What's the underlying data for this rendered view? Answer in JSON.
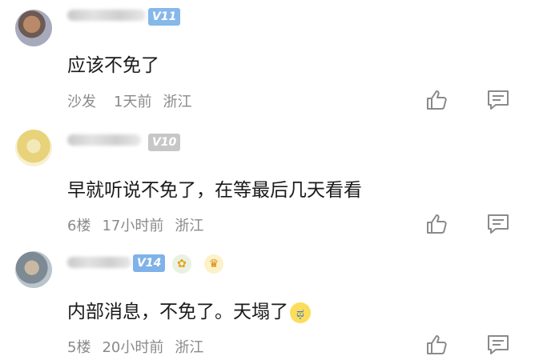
{
  "comments": [
    {
      "badge": "V11",
      "text": "应该不免了",
      "meta": {
        "floor": "沙发",
        "time": "1天前",
        "location": "浙江"
      }
    },
    {
      "badge": "V10",
      "text": "早就听说不免了，在等最后几天看看",
      "meta": {
        "floor": "6楼",
        "time": "17小时前",
        "location": "浙江"
      }
    },
    {
      "badge": "V14",
      "text": "内部消息，不免了。天塌了",
      "meta": {
        "floor": "5楼",
        "time": "20小时前",
        "location": "浙江"
      }
    }
  ],
  "icons": {
    "like": "thumbs-up-icon",
    "reply": "reply-icon",
    "emoji": "crying-face-icon",
    "medals": [
      "leaf-medal-icon",
      "crown-medal-icon"
    ]
  },
  "colors": {
    "badge_blue": "#86b8ea",
    "badge_gray": "#c7c7c7",
    "meta_gray": "#8a8a8a",
    "text": "#1a1a1a"
  }
}
